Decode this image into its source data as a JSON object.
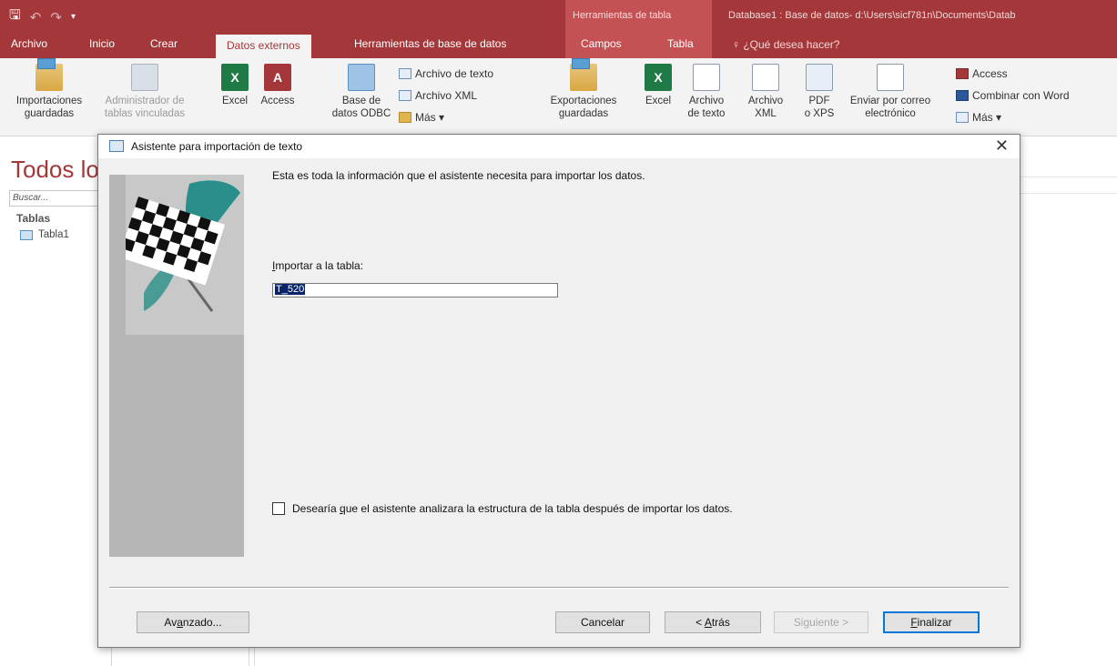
{
  "titlebar": {
    "table_tools_label": "Herramientas de tabla",
    "document_title": "Database1 : Base de datos- d:\\Users\\sicf781n\\Documents\\Datab"
  },
  "tabs": {
    "archivo": "Archivo",
    "inicio": "Inicio",
    "crear": "Crear",
    "datos_externos": "Datos externos",
    "herramientas_bd": "Herramientas de base de datos",
    "campos": "Campos",
    "tabla": "Tabla",
    "tell_me": "¿Qué desea hacer?"
  },
  "ribbon": {
    "importaciones_1": "Importaciones",
    "importaciones_2": "guardadas",
    "administrador_1": "Administrador de",
    "administrador_2": "tablas vinculadas",
    "excel": "Excel",
    "access": "Access",
    "odbc_1": "Base de",
    "odbc_2": "datos ODBC",
    "archivo_texto": "Archivo de texto",
    "archivo_xml": "Archivo XML",
    "mas_import": "Más ▾",
    "exportaciones_1": "Exportaciones",
    "exportaciones_2": "guardadas",
    "excel_export": "Excel",
    "archivo_texto_export_1": "Archivo",
    "archivo_texto_export_2": "de texto",
    "archivo_xml_export_1": "Archivo",
    "archivo_xml_export_2": "XML",
    "pdf_1": "PDF",
    "pdf_2": "o XPS",
    "email_1": "Enviar por correo",
    "email_2": "electrónico",
    "access_export": "Access",
    "combinar_word": "Combinar con Word",
    "mas_export": "Más ▾"
  },
  "navpane": {
    "title": "Todos lo",
    "search_placeholder": "Buscar...",
    "group": "Tablas",
    "item": "Tabla1"
  },
  "dialog": {
    "title": "Asistente para importación de texto",
    "close": "✕",
    "info": "Esta es toda la información que el asistente necesita para importar los datos.",
    "import_label_pre": "I",
    "import_label_rest": "mportar a la tabla:",
    "import_value": "T_520",
    "analyze_pre": "Desearía ",
    "analyze_key": "q",
    "analyze_rest": "ue el asistente analizara la estructura de la tabla después de importar los datos.",
    "btn_avanzado_pre": "Av",
    "btn_avanzado_key": "a",
    "btn_avanzado_rest": "nzado...",
    "btn_cancelar": "Cancelar",
    "btn_atras_pre": "< ",
    "btn_atras_key": "A",
    "btn_atras_rest": "trás",
    "btn_siguiente": "Siguiente >",
    "btn_finalizar_key": "F",
    "btn_finalizar_rest": "inalizar"
  }
}
